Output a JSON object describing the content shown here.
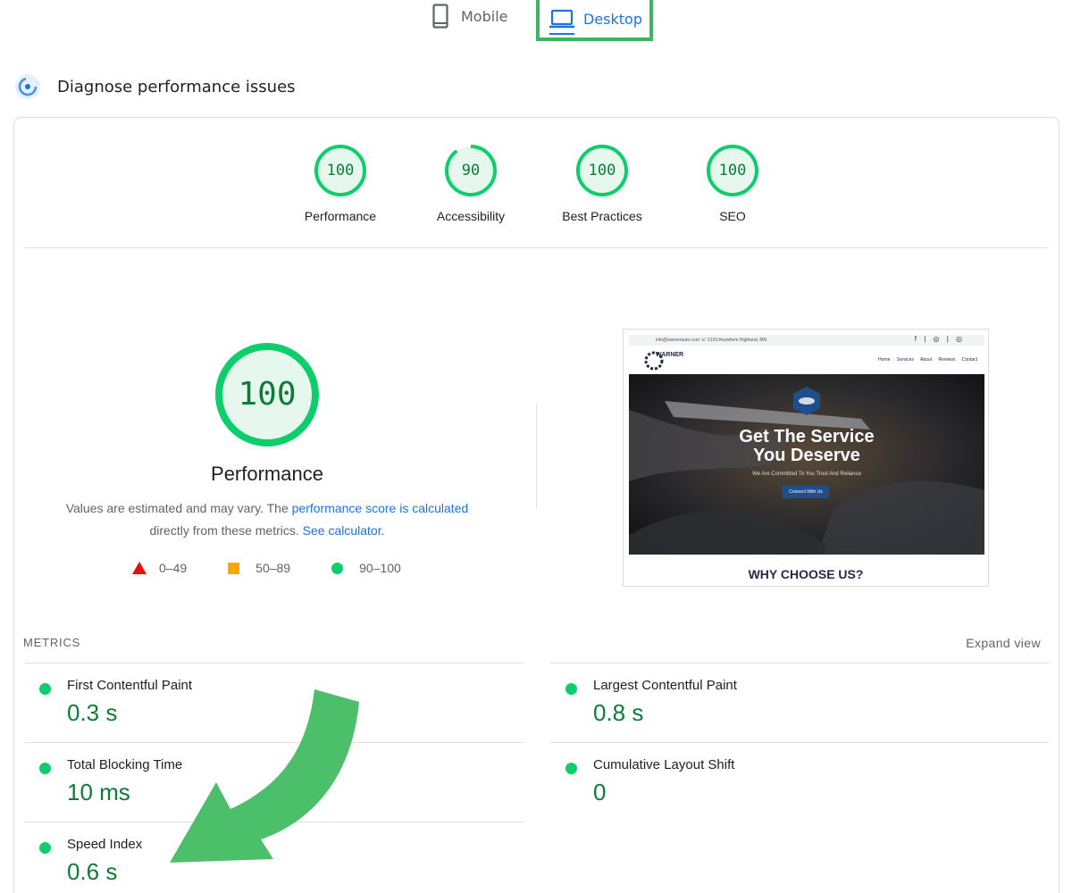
{
  "device_tabs": {
    "mobile_label": "Mobile",
    "desktop_label": "Desktop",
    "selected": "Desktop"
  },
  "diagnose": {
    "title": "Diagnose performance issues"
  },
  "scores": [
    {
      "label": "Performance",
      "value": "100",
      "fraction": 1.0
    },
    {
      "label": "Accessibility",
      "value": "90",
      "fraction": 0.9
    },
    {
      "label": "Best Practices",
      "value": "100",
      "fraction": 1.0
    },
    {
      "label": "SEO",
      "value": "100",
      "fraction": 1.0
    }
  ],
  "performance": {
    "score": "100",
    "title": "Performance",
    "desc_prefix": "Values are estimated and may vary. The ",
    "desc_link1": "performance score is calculated",
    "desc_mid": " directly from these metrics. ",
    "desc_link2": "See calculator",
    "desc_suffix": ".",
    "legend": [
      "0–49",
      "50–89",
      "90–100"
    ]
  },
  "screenshot": {
    "topbar_left": "info@warnerauto.com   ☏ 2103 Anywhere Highland, MN",
    "topbar_right": "f | ◎ | ◎",
    "logo_text": "WARNER",
    "menu": "Home Services About Reviews Contact",
    "hero_title_line1": "Get The Service",
    "hero_title_line2": "You Deserve",
    "hero_subtitle": "We Are Committed To You Trust And Reliance",
    "hero_button": "Connect With Us",
    "section_heading": "WHY CHOOSE US?"
  },
  "metrics": {
    "label": "METRICS",
    "expand_label": "Expand view",
    "items": [
      {
        "name": "First Contentful Paint",
        "value": "0.3 s"
      },
      {
        "name": "Largest Contentful Paint",
        "value": "0.8 s"
      },
      {
        "name": "Total Blocking Time",
        "value": "10 ms"
      },
      {
        "name": "Cumulative Layout Shift",
        "value": "0"
      },
      {
        "name": "Speed Index",
        "value": "0.6 s"
      }
    ]
  },
  "colors": {
    "pass": "#0cce6b",
    "pass_text": "#0c7c36",
    "average": "#ffa400",
    "fail": "#eb0f00",
    "link": "#1a73e8",
    "annotation": "#3cb464"
  }
}
